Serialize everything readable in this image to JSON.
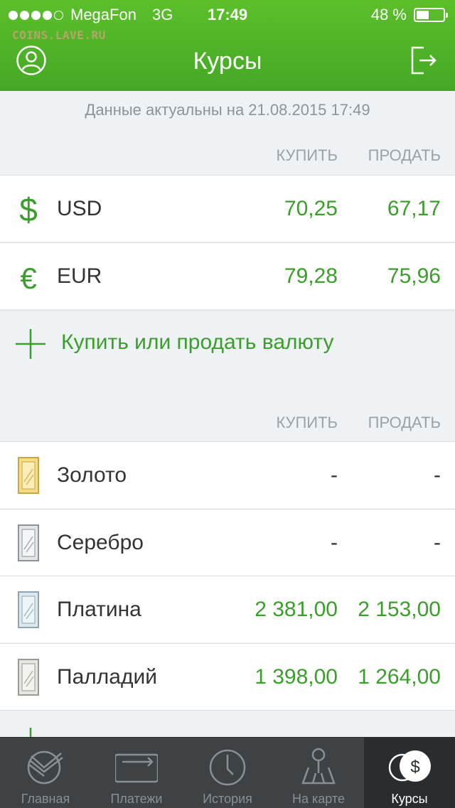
{
  "status_bar": {
    "carrier": "MegaFon",
    "network": "3G",
    "time": "17:49",
    "battery": "48 %",
    "battery_level": 0.48
  },
  "watermark": "COINS.LAVE.RU",
  "header": {
    "title": "Курсы"
  },
  "updated_text": "Данные актуальны на 21.08.2015 17:49",
  "currency_section": {
    "buy_header": "КУПИТЬ",
    "sell_header": "ПРОДАТЬ",
    "rows": [
      {
        "code": "USD",
        "icon": "dollar-icon",
        "buy": "70,25",
        "sell": "67,17"
      },
      {
        "code": "EUR",
        "icon": "euro-icon",
        "buy": "79,28",
        "sell": "75,96"
      }
    ],
    "action_label": "Купить или продать валюту"
  },
  "metals_section": {
    "buy_header": "КУПИТЬ",
    "sell_header": "ПРОДАТЬ",
    "rows": [
      {
        "name": "Золото",
        "icon": "gold-bar-icon",
        "buy": "-",
        "sell": "-"
      },
      {
        "name": "Серебро",
        "icon": "silver-bar-icon",
        "buy": "-",
        "sell": "-"
      },
      {
        "name": "Платина",
        "icon": "platinum-bar-icon",
        "buy": "2 381,00",
        "sell": "2 153,00"
      },
      {
        "name": "Палладий",
        "icon": "palladium-bar-icon",
        "buy": "1 398,00",
        "sell": "1 264,00"
      }
    ]
  },
  "tabbar": {
    "tabs": [
      {
        "label": "Главная",
        "icon": "sberbank-logo-icon"
      },
      {
        "label": "Платежи",
        "icon": "payments-icon"
      },
      {
        "label": "История",
        "icon": "clock-icon"
      },
      {
        "label": "На карте",
        "icon": "map-pin-icon"
      },
      {
        "label": "Курсы",
        "icon": "coins-icon",
        "active": true
      }
    ]
  },
  "colors": {
    "header_green": "#4cb428",
    "value_green": "#3a9f2a",
    "gold": "#e8c468",
    "silver": "#b9bfc3",
    "platinum": "#c9dde6",
    "palladium": "#d8d8d0"
  }
}
